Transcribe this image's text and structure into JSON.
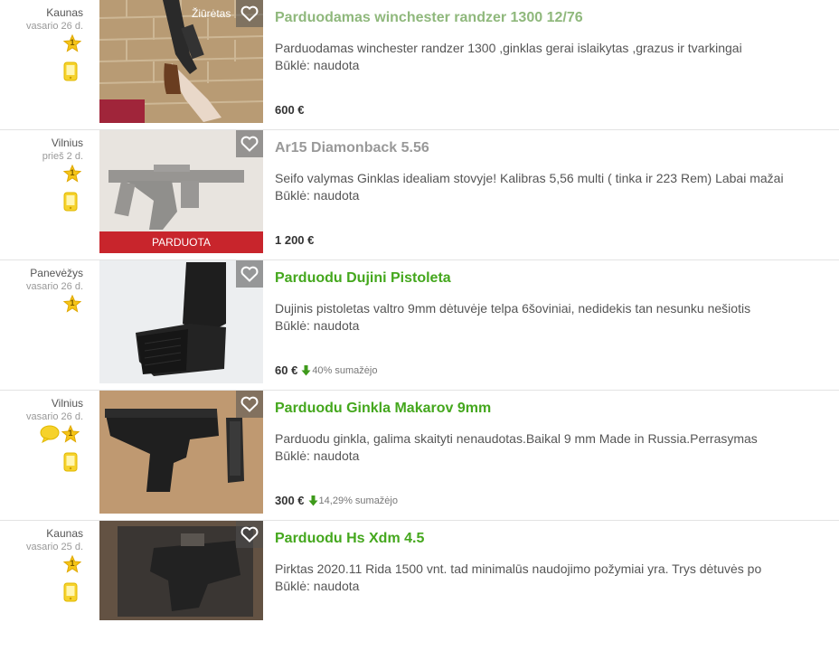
{
  "listings": [
    {
      "city": "Kaunas",
      "date": "vasario 26 d.",
      "star_count": "1",
      "chat": false,
      "seen_label": "Žiūrėtas",
      "sold_label": "",
      "title": "Parduodamas winchester randzer 1300 12/76",
      "title_state": "visited",
      "description": "Parduodamas winchester randzer 1300 ,ginklas gerai islaikytas ,grazus ir tvarkingai",
      "condition": "Būklė: naudota",
      "price": "600 €",
      "price_drop": ""
    },
    {
      "city": "Vilnius",
      "date": "prieš 2 d.",
      "star_count": "1",
      "chat": false,
      "seen_label": "",
      "sold_label": "PARDUOTA",
      "title": "Ar15 Diamonback 5.56",
      "title_state": "grey",
      "description": "Seifo valymas Ginklas idealiam stovyje! Kalibras 5,56 multi ( tinka ir 223 Rem) Labai mažai",
      "condition": "Būklė: naudota",
      "price": "1 200 €",
      "price_drop": ""
    },
    {
      "city": "Panevėžys",
      "date": "vasario 26 d.",
      "star_count": "1",
      "chat": false,
      "seen_label": "",
      "sold_label": "",
      "title": "Parduodu Dujini Pistoleta",
      "title_state": "green",
      "description": "Dujinis pistoletas valtro 9mm dėtuvėje telpa 6šoviniai, nedidekis tan nesunku nešiotis",
      "condition": "Būklė: naudota",
      "price": "60 €",
      "price_drop": "40% sumažėjo"
    },
    {
      "city": "Vilnius",
      "date": "vasario 26 d.",
      "star_count": "1",
      "chat": true,
      "seen_label": "",
      "sold_label": "",
      "title": "Parduodu Ginkla Makarov 9mm",
      "title_state": "green",
      "description": "Parduodu ginkla, galima skaityti nenaudotas.Baikal 9 mm Made in Russia.Perrasymas",
      "condition": "Būklė: naudota",
      "price": "300 €",
      "price_drop": "14,29% sumažėjo"
    },
    {
      "city": "Kaunas",
      "date": "vasario 25 d.",
      "star_count": "1",
      "chat": false,
      "seen_label": "",
      "sold_label": "",
      "title": "Parduodu Hs Xdm 4.5",
      "title_state": "green",
      "description": "Pirktas 2020.11 Rida 1500 vnt. tad minimalūs naudojimo požymiai yra. Trys dėtuvės po",
      "condition": "Būklė: naudota",
      "price": "",
      "price_drop": ""
    }
  ]
}
